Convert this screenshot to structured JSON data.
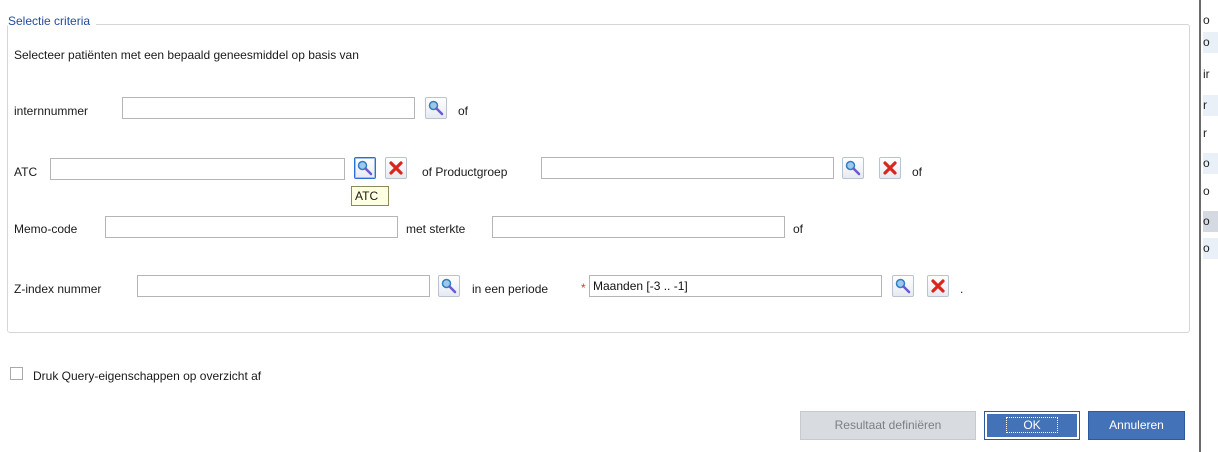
{
  "section": {
    "legend": "Selectie criteria",
    "intro": "Selecteer patiënten met een bepaald geneesmiddel op basis van"
  },
  "rows": {
    "internnummer": {
      "label": "internnummer",
      "value": "",
      "suffix": "of"
    },
    "atc": {
      "label": "ATC",
      "value": "",
      "suffix": "of Productgroep",
      "tooltip": "ATC"
    },
    "productgroep": {
      "value": "",
      "suffix": "of"
    },
    "memo": {
      "label": "Memo-code",
      "value": "",
      "middle": "met sterkte",
      "suffix": "of"
    },
    "sterkte": {
      "value": ""
    },
    "zindex": {
      "label": "Z-index nummer",
      "value": "",
      "middle": "in een periode",
      "required_mark": "*"
    },
    "periode": {
      "value": "Maanden [-3 .. -1]",
      "suffix": "."
    }
  },
  "print_option": {
    "label": "Druk Query-eigenschappen op overzicht af",
    "checked": false
  },
  "buttons": {
    "define_result": "Resultaat definiëren",
    "ok": "OK",
    "cancel": "Annuleren"
  },
  "right_strip": [
    "o",
    "o",
    "ir",
    "r",
    "r",
    "o",
    "o",
    "o",
    "o"
  ],
  "icons": {
    "lookup": "magnifier-pin-icon",
    "clear": "red-x-icon"
  },
  "colors": {
    "accent": "#4472b8",
    "legend": "#1f4c9a",
    "required": "#d93a2b",
    "clear": "#d9261c"
  }
}
